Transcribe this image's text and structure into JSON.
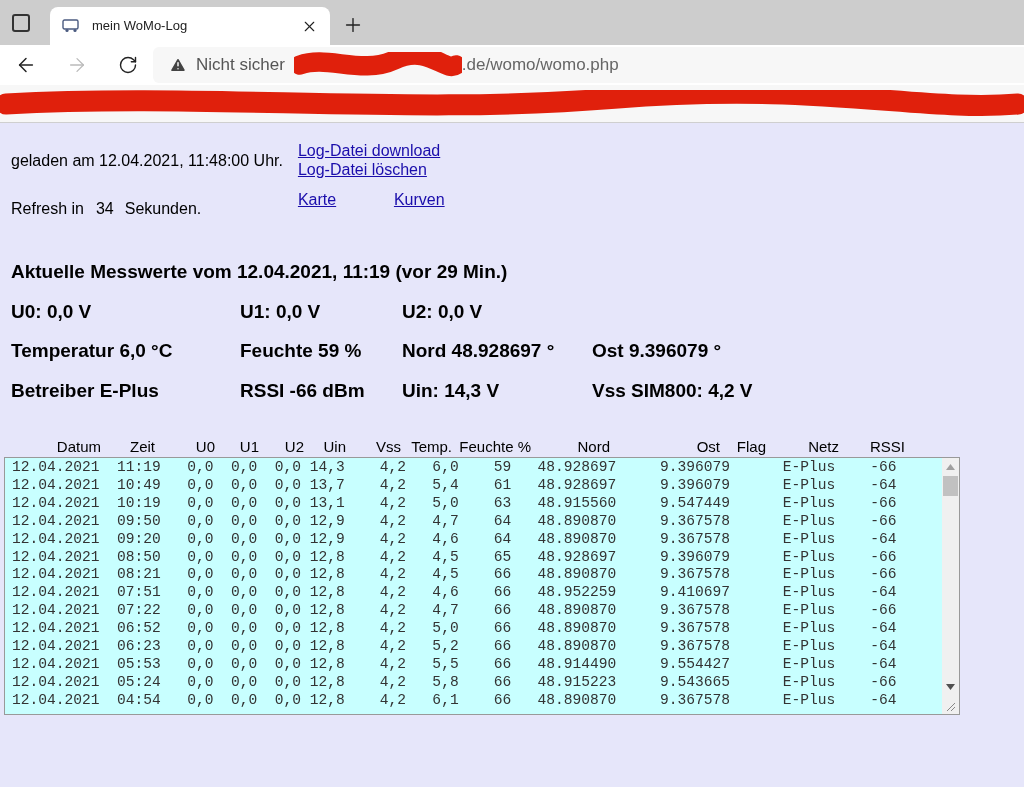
{
  "browser": {
    "tab_title": "mein WoMo-Log",
    "security_label": "Nicht sicher",
    "url_visible": ".de/womo/womo.php"
  },
  "info": {
    "loaded": "geladen am 12.04.2021, 11:48:00 Uhr.",
    "file_links": [
      "Log-Datei download",
      "Log-Datei löschen"
    ],
    "refresh_label": "Refresh in",
    "refresh_seconds": "34",
    "refresh_unit": "Sekunden.",
    "nav_links": [
      "Karte",
      "Kurven"
    ]
  },
  "current": {
    "title": "Aktuelle Messwerte vom 12.04.2021, 11:19 (vor 29 Min.)",
    "rows": [
      [
        "U0: 0,0 V",
        "U1: 0,0 V",
        "U2: 0,0 V"
      ],
      [
        "Temperatur 6,0 °C",
        "Feuchte 59 %",
        "Nord 48.928697 °",
        "Ost 9.396079 °"
      ],
      [
        "Betreiber E-Plus",
        "RSSI -66 dBm",
        "Uin: 14,3 V",
        "Vss SIM800: 4,2 V"
      ]
    ]
  },
  "log": {
    "columns": [
      "Datum",
      "Zeit",
      "U0",
      "U1",
      "U2",
      "Uin",
      "Vss",
      "Temp.",
      "Feuchte %",
      "Nord",
      "Ost",
      "Flag",
      "Netz",
      "RSSI"
    ],
    "lines": [
      "12.04.2021  11:19   0,0  0,0  0,0 14,3    4,2   6,0    59   48.928697     9.396079      E-Plus    -66",
      "12.04.2021  10:49   0,0  0,0  0,0 13,7    4,2   5,4    61   48.928697     9.396079      E-Plus    -64",
      "12.04.2021  10:19   0,0  0,0  0,0 13,1    4,2   5,0    63   48.915560     9.547449      E-Plus    -66",
      "12.04.2021  09:50   0,0  0,0  0,0 12,9    4,2   4,7    64   48.890870     9.367578      E-Plus    -66",
      "12.04.2021  09:20   0,0  0,0  0,0 12,9    4,2   4,6    64   48.890870     9.367578      E-Plus    -64",
      "12.04.2021  08:50   0,0  0,0  0,0 12,8    4,2   4,5    65   48.928697     9.396079      E-Plus    -66",
      "12.04.2021  08:21   0,0  0,0  0,0 12,8    4,2   4,5    66   48.890870     9.367578      E-Plus    -66",
      "12.04.2021  07:51   0,0  0,0  0,0 12,8    4,2   4,6    66   48.952259     9.410697      E-Plus    -64",
      "12.04.2021  07:22   0,0  0,0  0,0 12,8    4,2   4,7    66   48.890870     9.367578      E-Plus    -66",
      "12.04.2021  06:52   0,0  0,0  0,0 12,8    4,2   5,0    66   48.890870     9.367578      E-Plus    -64",
      "12.04.2021  06:23   0,0  0,0  0,0 12,8    4,2   5,2    66   48.890870     9.367578      E-Plus    -64",
      "12.04.2021  05:53   0,0  0,0  0,0 12,8    4,2   5,5    66   48.914490     9.554427      E-Plus    -64",
      "12.04.2021  05:24   0,0  0,0  0,0 12,8    4,2   5,8    66   48.915223     9.543665      E-Plus    -66",
      "12.04.2021  04:54   0,0  0,0  0,0 12,8    4,2   6,1    66   48.890870     9.367578      E-Plus    -64"
    ]
  }
}
